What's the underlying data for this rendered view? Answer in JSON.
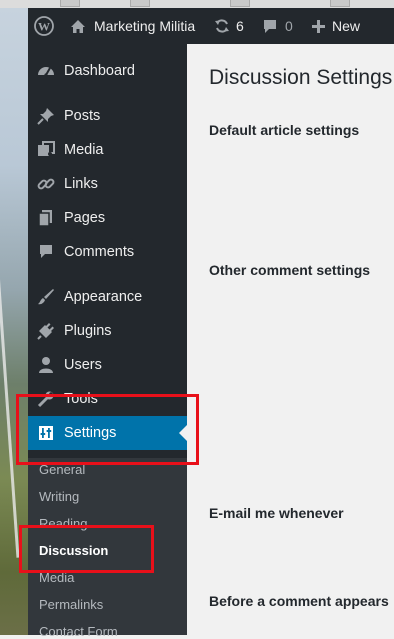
{
  "adminbar": {
    "site_name": "Marketing Militia",
    "updates_count": "6",
    "comments_count": "0",
    "new_label": "New"
  },
  "sidebar": {
    "items": [
      {
        "label": "Dashboard",
        "icon": "dashboard-icon"
      },
      {
        "label": "Posts",
        "icon": "pin-icon"
      },
      {
        "label": "Media",
        "icon": "media-icon"
      },
      {
        "label": "Links",
        "icon": "link-icon"
      },
      {
        "label": "Pages",
        "icon": "pages-icon"
      },
      {
        "label": "Comments",
        "icon": "comment-icon"
      },
      {
        "label": "Appearance",
        "icon": "brush-icon"
      },
      {
        "label": "Plugins",
        "icon": "plug-icon"
      },
      {
        "label": "Users",
        "icon": "user-icon"
      },
      {
        "label": "Tools",
        "icon": "wrench-icon"
      },
      {
        "label": "Settings",
        "icon": "settings-icon"
      }
    ],
    "submenu": [
      {
        "label": "General"
      },
      {
        "label": "Writing"
      },
      {
        "label": "Reading"
      },
      {
        "label": "Discussion"
      },
      {
        "label": "Media"
      },
      {
        "label": "Permalinks"
      },
      {
        "label": "Contact Form"
      }
    ]
  },
  "main": {
    "title": "Discussion Settings",
    "sections": [
      {
        "label": "Default article settings"
      },
      {
        "label": "Other comment settings"
      },
      {
        "label": "E-mail me whenever"
      },
      {
        "label": "Before a comment appears"
      }
    ]
  },
  "colors": {
    "adminbar_bg": "#23282d",
    "active_blue": "#0073aa",
    "highlight_red": "#e8101a"
  }
}
